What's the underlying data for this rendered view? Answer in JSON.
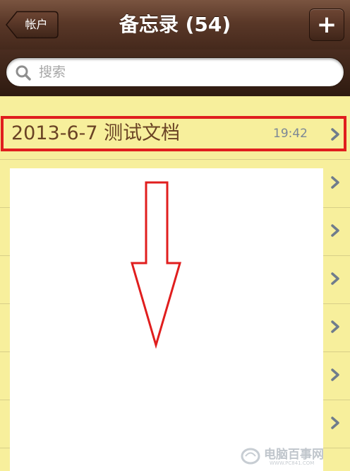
{
  "nav": {
    "title": "备忘录 (54)",
    "back_label": "帐户",
    "add_label": "+"
  },
  "search": {
    "placeholder": "搜索"
  },
  "notes": [
    {
      "title": "2013-6-7 测试文档",
      "time": "19:42"
    }
  ],
  "hidden_rows": 7,
  "annotation": {
    "highlight_color": "#e01e1e",
    "arrow": "down-arrow"
  },
  "colors": {
    "nav_brown": "#5a3828",
    "paper_yellow": "#f7ef9c",
    "note_text": "#6a4325",
    "time_text": "#7b8796",
    "chevron": "#6f7c8c"
  },
  "watermark": {
    "text": "电脑百事网",
    "sub": "WWW.PC841.COM"
  }
}
